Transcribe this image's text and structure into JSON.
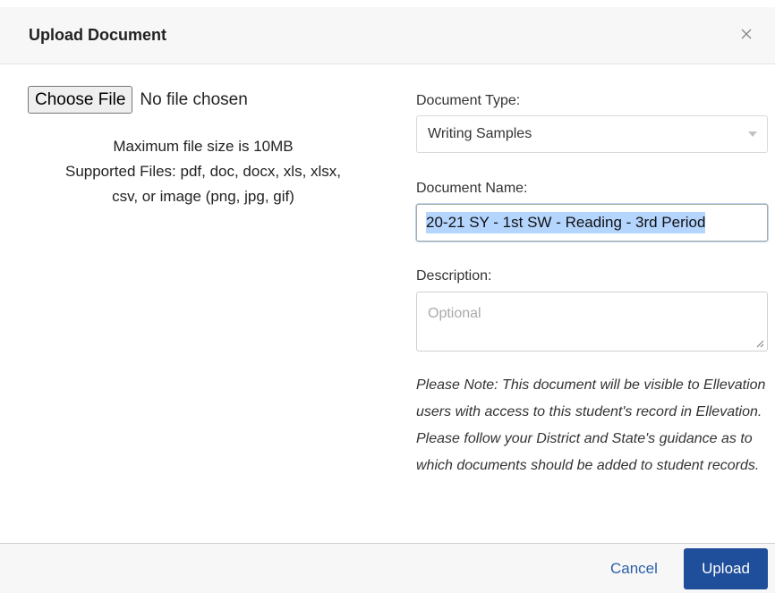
{
  "header": {
    "title": "Upload Document",
    "close_icon": "close-icon"
  },
  "file": {
    "choose_label": "Choose File",
    "status": "No file chosen",
    "info_lines": [
      "Maximum file size is 10MB",
      "Supported Files: pdf, doc, docx, xls, xlsx,",
      "csv, or image (png, jpg, gif)"
    ]
  },
  "form": {
    "type_label": "Document Type:",
    "type_value": "Writing Samples",
    "name_label": "Document Name:",
    "name_value": "20-21 SY - 1st SW - Reading - 3rd Period",
    "description_label": "Description:",
    "description_placeholder": "Optional"
  },
  "note": "Please Note: This document will be visible to Ellevation users with access to this student's record in Ellevation. Please follow your District and State's guidance as to which documents should be added to student records.",
  "footer": {
    "cancel_label": "Cancel",
    "upload_label": "Upload"
  },
  "colors": {
    "primary": "#1f4e9a",
    "link": "#2b5fa7",
    "selection": "#b4d5fe"
  }
}
